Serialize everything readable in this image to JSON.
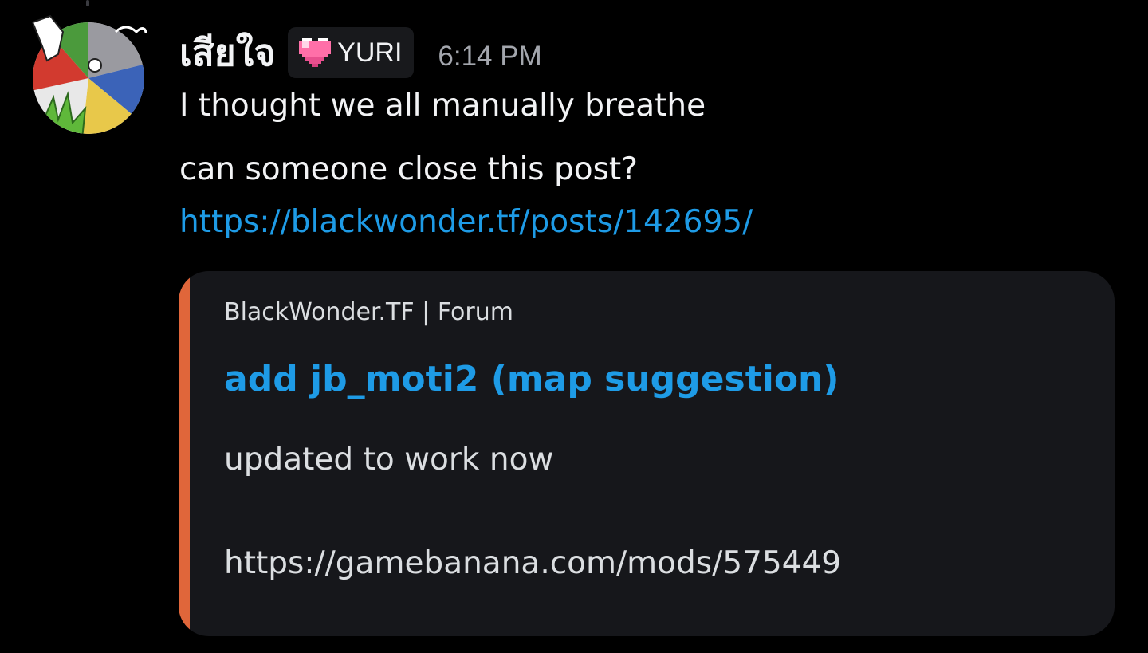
{
  "message": {
    "author": {
      "username": "เสียใจ",
      "tag_label": "YURI",
      "tag_icon": "pixel-heart-icon",
      "tag_icon_color": "#ff6fa8",
      "avatar": "user-avatar"
    },
    "timestamp": "6:14 PM",
    "lines": [
      "I thought we all manually breathe",
      "can someone close this post?"
    ],
    "link": "https://blackwonder.tf/posts/142695/",
    "link_color": "#1e9be6"
  },
  "embed": {
    "accent_color": "#e0663a",
    "provider": "BlackWonder.TF | Forum",
    "title": "add jb_moti2 (map suggestion)",
    "description_lines": [
      "updated to work now",
      "https://gamebanana.com/mods/575449"
    ]
  }
}
